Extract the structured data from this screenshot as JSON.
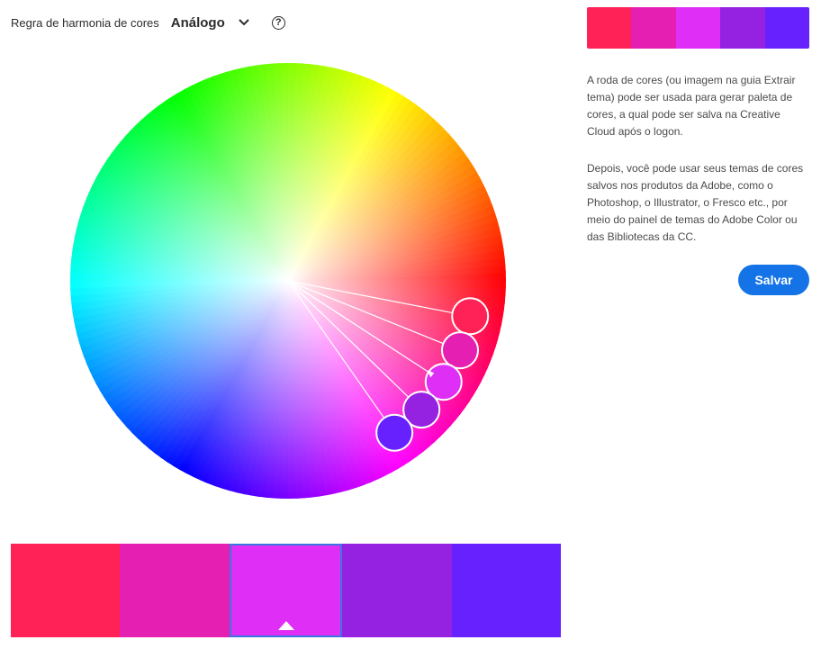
{
  "harmony": {
    "label": "Regra de harmonia de cores",
    "selected": "Análogo",
    "help_symbol": "?"
  },
  "colors": [
    "#FF2257",
    "#E51FB2",
    "#DF2FF7",
    "#9521E1",
    "#6721FF"
  ],
  "selected_index": 2,
  "wheel": {
    "handle_angles_deg": [
      -11,
      -22,
      -33,
      -44,
      -55
    ]
  },
  "info": {
    "paragraph1": "A roda de cores (ou imagem na guia Extrair tema) pode ser usada para gerar paleta de cores, a qual pode ser salva na Creative Cloud após o logon.",
    "paragraph2": "Depois, você pode usar seus temas de cores salvos nos produtos da Adobe, como o Photoshop, o Illustrator, o Fresco etc., por meio do painel de temas do Adobe Color ou das Bibliotecas da CC."
  },
  "save_label": "Salvar"
}
